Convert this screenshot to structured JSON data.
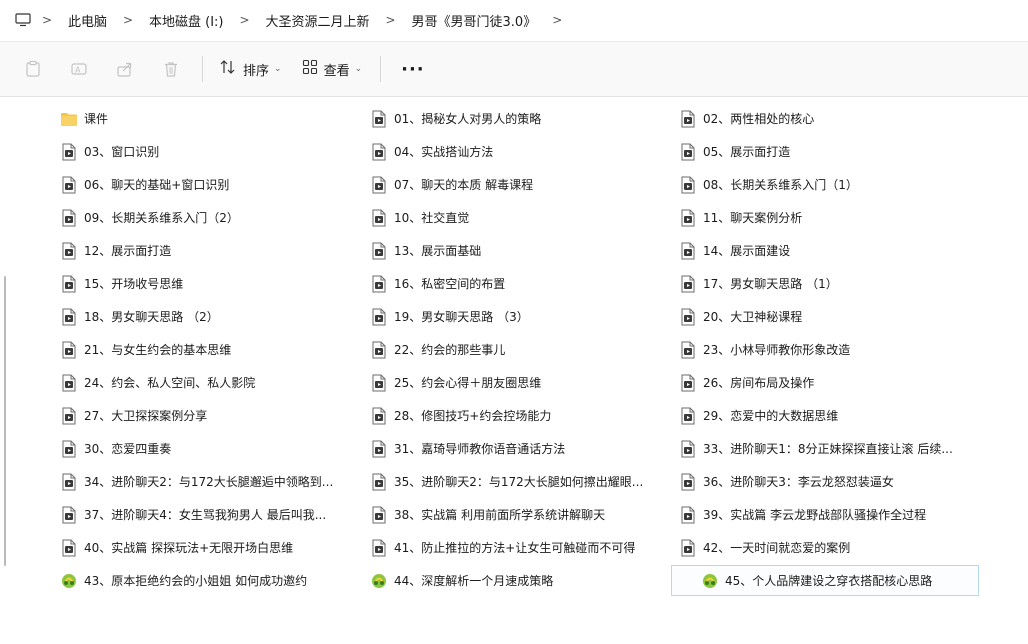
{
  "breadcrumb": [
    "此电脑",
    "本地磁盘 (I:)",
    "大圣资源二月上新",
    "男哥《男哥门徒3.0》"
  ],
  "toolbar": {
    "sort_label": "排序",
    "view_label": "查看",
    "more_label": "···"
  },
  "icons": {
    "folder": "folder-icon",
    "video": "video-file-icon",
    "audio": "audio-file-icon",
    "monitor": "monitor-icon"
  },
  "colors": {
    "folder": "#f3c64b",
    "selection_border": "#b5dbea"
  },
  "files": [
    {
      "name": "课件",
      "type": "folder"
    },
    {
      "name": "01、揭秘女人对男人的策略",
      "type": "video"
    },
    {
      "name": "02、两性相处的核心",
      "type": "video"
    },
    {
      "name": "03、窗口识别",
      "type": "video"
    },
    {
      "name": "04、实战搭讪方法",
      "type": "video"
    },
    {
      "name": "05、展示面打造",
      "type": "video"
    },
    {
      "name": "06、聊天的基础+窗口识别",
      "type": "video"
    },
    {
      "name": "07、聊天的本质 解毒课程",
      "type": "video"
    },
    {
      "name": "08、长期关系维系入门（1）",
      "type": "video"
    },
    {
      "name": "09、长期关系维系入门（2）",
      "type": "video"
    },
    {
      "name": "10、社交直觉",
      "type": "video"
    },
    {
      "name": "11、聊天案例分析",
      "type": "video"
    },
    {
      "name": "12、展示面打造",
      "type": "video"
    },
    {
      "name": "13、展示面基础",
      "type": "video"
    },
    {
      "name": "14、展示面建设",
      "type": "video"
    },
    {
      "name": "15、开场收号思维",
      "type": "video"
    },
    {
      "name": "16、私密空间的布置",
      "type": "video"
    },
    {
      "name": "17、男女聊天思路 （1）",
      "type": "video"
    },
    {
      "name": "18、男女聊天思路 （2）",
      "type": "video"
    },
    {
      "name": "19、男女聊天思路 （3）",
      "type": "video"
    },
    {
      "name": "20、大卫神秘课程",
      "type": "video"
    },
    {
      "name": "21、与女生约会的基本思维",
      "type": "video"
    },
    {
      "name": "22、约会的那些事儿",
      "type": "video"
    },
    {
      "name": "23、小林导师教你形象改造",
      "type": "video"
    },
    {
      "name": "24、约会、私人空间、私人影院",
      "type": "video"
    },
    {
      "name": "25、约会心得＋朋友圈思维",
      "type": "video"
    },
    {
      "name": "26、房间布局及操作",
      "type": "video"
    },
    {
      "name": "27、大卫探探案例分享",
      "type": "video"
    },
    {
      "name": "28、修图技巧+约会控场能力",
      "type": "video"
    },
    {
      "name": "29、恋爱中的大数据思维",
      "type": "video"
    },
    {
      "name": "30、恋爱四重奏",
      "type": "video"
    },
    {
      "name": "31、嘉琦导师教你语音通话方法",
      "type": "video"
    },
    {
      "name": "33、进阶聊天1：8分正妹探探直接让滚 后续...",
      "type": "video"
    },
    {
      "name": "34、进阶聊天2：与172大长腿邂逅中领略到...",
      "type": "video"
    },
    {
      "name": "35、进阶聊天2：与172大长腿如何擦出耀眼...",
      "type": "video"
    },
    {
      "name": "36、进阶聊天3：李云龙怒怼装逼女",
      "type": "video"
    },
    {
      "name": "37、进阶聊天4：女生骂我狗男人 最后叫我...",
      "type": "video"
    },
    {
      "name": "38、实战篇 利用前面所学系统讲解聊天",
      "type": "video"
    },
    {
      "name": "39、实战篇 李云龙野战部队骚操作全过程",
      "type": "video"
    },
    {
      "name": "40、实战篇 探探玩法+无限开场白思维",
      "type": "video"
    },
    {
      "name": "41、防止推拉的方法+让女生可触碰而不可得",
      "type": "video"
    },
    {
      "name": "42、一天时间就恋爱的案例",
      "type": "video"
    },
    {
      "name": "43、原本拒绝约会的小姐姐 如何成功邀约",
      "type": "audio"
    },
    {
      "name": "44、深度解析一个月速成策略",
      "type": "audio"
    },
    {
      "name": "45、个人品牌建设之穿衣搭配核心思路",
      "type": "audio",
      "selected": true
    }
  ]
}
